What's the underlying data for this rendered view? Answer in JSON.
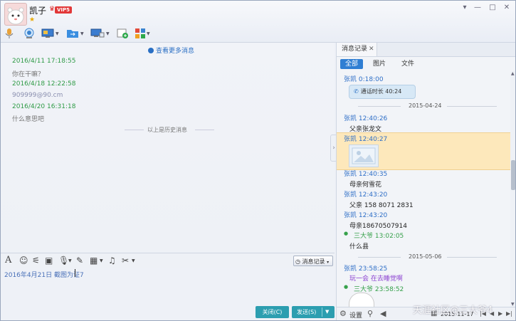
{
  "header": {
    "contact_name": "凯子",
    "vip_label": "VIP5",
    "star": "★"
  },
  "window_controls": [
    "▾",
    "—",
    "□",
    "✕"
  ],
  "toolbar": {
    "icons": [
      "microphone-icon",
      "webcam-icon",
      "screen-share-icon",
      "folder-transfer-icon",
      "remote-desktop-icon",
      "add-chat-icon",
      "apps-icon"
    ]
  },
  "chat": {
    "more_messages": "查看更多消息",
    "messages": [
      {
        "time": "2016/4/11 17:18:55",
        "text": "你在干嘛？"
      },
      {
        "time": "2016/4/18 12:22:58",
        "text": "909999@90.cm"
      },
      {
        "time": "2016/4/20 16:31:18",
        "text": "什么意思吧"
      }
    ],
    "history_divider": "以上是历史消息"
  },
  "input_toolbar": {
    "history_button": "消息记录"
  },
  "input": {
    "text": "2016年4月21日 截图为证7"
  },
  "buttons": {
    "close": "关闭(C)",
    "send": "发送(S)"
  },
  "right_panel": {
    "tab_title": "消息记录",
    "filters": [
      "全部",
      "图片",
      "文件"
    ],
    "entries": {
      "e1_sender": "张凯  0:18:00",
      "call_text": "通话时长 40:24",
      "date1": "2015-04-24",
      "e2_sender": "张凯  12:40:26",
      "e2_text": "父亲张龙文",
      "e3_sender": "张凯  12:40:27",
      "e4_sender": "张凯  12:40:35",
      "e4_text": "母亲何雪花",
      "e5_sender": "张凯  12:43:20",
      "e5_text": "父亲 158 8071 2831",
      "e6_sender": "张凯  12:43:20",
      "e6_text": "母亲18670507914",
      "e7_sender": "三大爷  13:02:05",
      "e7_text": "什么县",
      "date2": "2015-05-06",
      "e8_sender": "张凯  23:58:25",
      "e8_text": "玩一会 在去睡觉啊",
      "e9_sender": "三大爷  23:58:52"
    },
    "bottom": {
      "settings": "设置",
      "date": "2015-11-17"
    }
  },
  "watermark": "天涯社区@三大爷4"
}
